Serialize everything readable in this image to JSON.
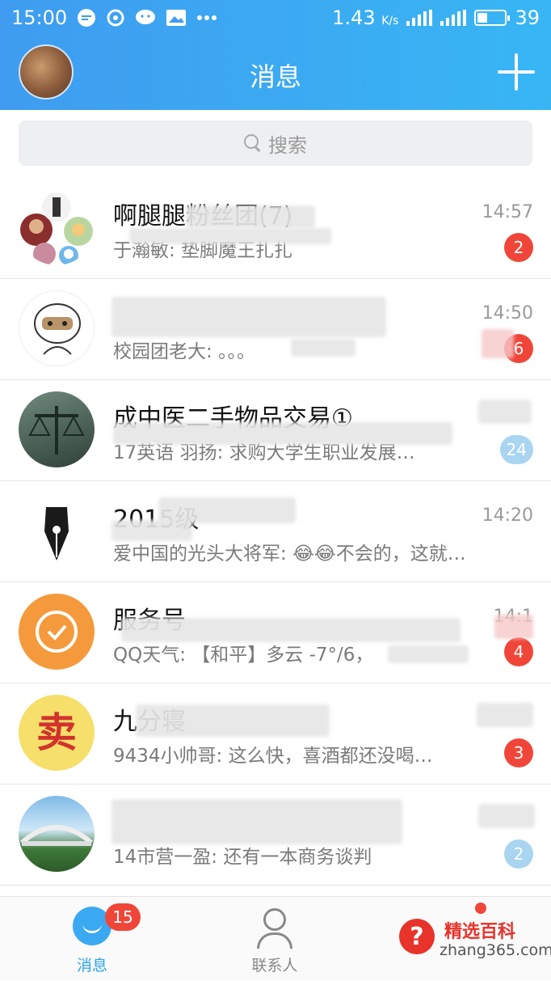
{
  "status_bar": {
    "time": "15:00",
    "speed": "1.43",
    "speed_unit": "K/s",
    "battery": "39",
    "battery_level": 0.39,
    "icons": [
      "chat-bubble-icon",
      "weibo-icon",
      "wechat-icon",
      "gallery-icon",
      "more-dots-icon"
    ]
  },
  "header": {
    "title": "消息",
    "add_label": "+"
  },
  "search": {
    "placeholder": "搜索"
  },
  "conversations": [
    {
      "name": "啊腿腿粉丝团(7)",
      "preview": "于瀚敏: 垫脚魔王扎扎",
      "time": "14:57",
      "badge": "2",
      "badge_style": "red"
    },
    {
      "name": "",
      "preview": "校园团老大: 。。。",
      "time": "14:50",
      "badge": "6",
      "badge_style": "red"
    },
    {
      "name": "成中医二手物品交易①",
      "preview": "17英语 羽扬: 求购大学生职业发展…",
      "time": "",
      "badge": "24",
      "badge_style": "blue"
    },
    {
      "name": "2015级",
      "preview": "爱中国的光头大将军: 😂😂不会的，这就…",
      "time": "14:20",
      "badge": "",
      "badge_style": ""
    },
    {
      "name": "服务号",
      "preview": "QQ天气: 【和平】多云 -7°/6，",
      "time": "14:1",
      "badge": "4",
      "badge_style": "red"
    },
    {
      "name": "九分寝",
      "preview": "9434小帅哥: 这么快，喜酒都还没喝…",
      "time": "",
      "badge": "3",
      "badge_style": "red"
    },
    {
      "name": "",
      "preview": "14市营一盈: 还有一本商务谈判",
      "time": "",
      "badge": "2",
      "badge_style": "blue"
    }
  ],
  "tabbar": {
    "messages_label": "消息",
    "messages_badge": "15",
    "contacts_label": "联系人"
  },
  "watermark": {
    "title": "精选百科",
    "subtitle": "zhang365.com",
    "symbol": "?"
  },
  "colors": {
    "accent": "#3ba8f2",
    "badge_red": "#f0463a",
    "badge_blue": "#a9d5f1"
  }
}
